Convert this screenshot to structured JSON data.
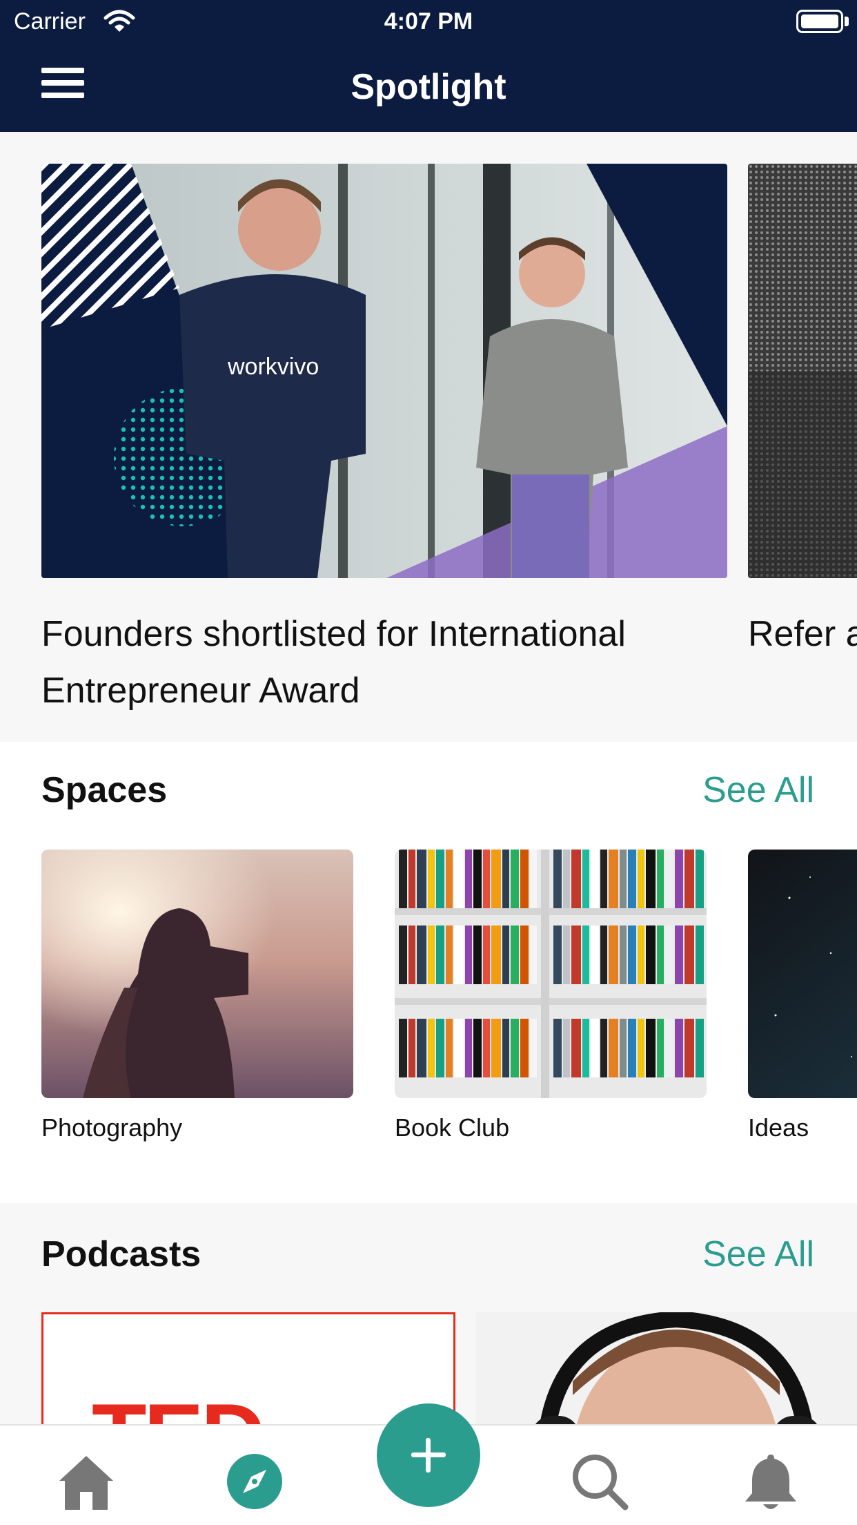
{
  "status_bar": {
    "carrier": "Carrier",
    "time": "4:07 PM"
  },
  "nav": {
    "title": "Spotlight"
  },
  "featured": [
    {
      "title": "Founders shortlisted for International Entrepreneur Award",
      "image": "workvivo-founders-photo",
      "shirt_text": "workvivo"
    },
    {
      "title": "Refer a",
      "image": "building-photo"
    }
  ],
  "spaces": {
    "title": "Spaces",
    "see_all": "See All",
    "items": [
      {
        "label": "Photography",
        "image": "photographer-sunset"
      },
      {
        "label": "Book Club",
        "image": "bookshelf"
      },
      {
        "label": "Ideas",
        "image": "night-sky"
      }
    ]
  },
  "podcasts": {
    "title": "Podcasts",
    "see_all": "See All",
    "items": [
      {
        "image": "ted-logo",
        "logo_text": "TED"
      },
      {
        "image": "man-headphones"
      }
    ]
  },
  "tabbar": {
    "items": [
      "home-icon",
      "compass-icon",
      "add-icon",
      "search-icon",
      "bell-icon"
    ],
    "active": "compass-icon",
    "accent": "#2a9d8f"
  },
  "colors": {
    "header": "#0b1c40",
    "accent": "#2a9d8f"
  }
}
